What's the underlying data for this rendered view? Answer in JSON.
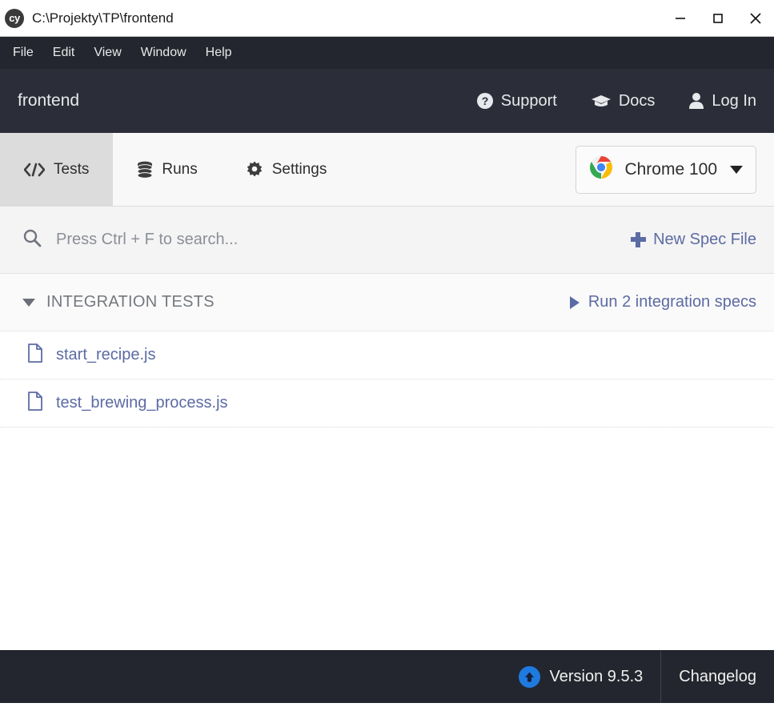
{
  "titlebar": {
    "logo_text": "cy",
    "title": "C:\\Projekty\\TP\\frontend",
    "minimize_label": "—",
    "maximize_label": "□",
    "close_label": "✕"
  },
  "menubar": {
    "items": [
      {
        "label": "File"
      },
      {
        "label": "Edit"
      },
      {
        "label": "View"
      },
      {
        "label": "Window"
      },
      {
        "label": "Help"
      }
    ]
  },
  "header": {
    "project_name": "frontend",
    "nav": [
      {
        "label": "Support",
        "icon": "question-circle-icon"
      },
      {
        "label": "Docs",
        "icon": "graduation-cap-icon"
      },
      {
        "label": "Log In",
        "icon": "user-icon"
      }
    ]
  },
  "tabs": {
    "items": [
      {
        "label": "Tests",
        "icon": "code-icon",
        "active": true
      },
      {
        "label": "Runs",
        "icon": "database-icon",
        "active": false
      },
      {
        "label": "Settings",
        "icon": "gear-icon",
        "active": false
      }
    ],
    "browser_selector": {
      "label": "Chrome 100",
      "icon": "chrome-icon",
      "caret": "chevron-down-icon"
    }
  },
  "search": {
    "icon": "search-icon",
    "placeholder": "Press Ctrl + F to search...",
    "new_spec_label": "New Spec File",
    "new_spec_icon": "plus-icon"
  },
  "group": {
    "toggle_icon": "caret-down-icon",
    "title": "INTEGRATION TESTS",
    "run_label": "Run 2 integration specs",
    "run_icon": "play-icon"
  },
  "specs": [
    {
      "name": "start_recipe.js",
      "icon": "file-icon"
    },
    {
      "name": "test_brewing_process.js",
      "icon": "file-icon"
    }
  ],
  "footer": {
    "version_label": "Version 9.5.3",
    "version_icon": "arrow-up-circle-icon",
    "changelog_label": "Changelog"
  },
  "colors": {
    "header_bg": "#2b2e38",
    "menubar_bg": "#23262e",
    "footer_bg": "#23262e",
    "accent_link": "#5c6ba4",
    "update_badge": "#1f7ae0",
    "active_tab_bg": "#dcdcdc"
  }
}
